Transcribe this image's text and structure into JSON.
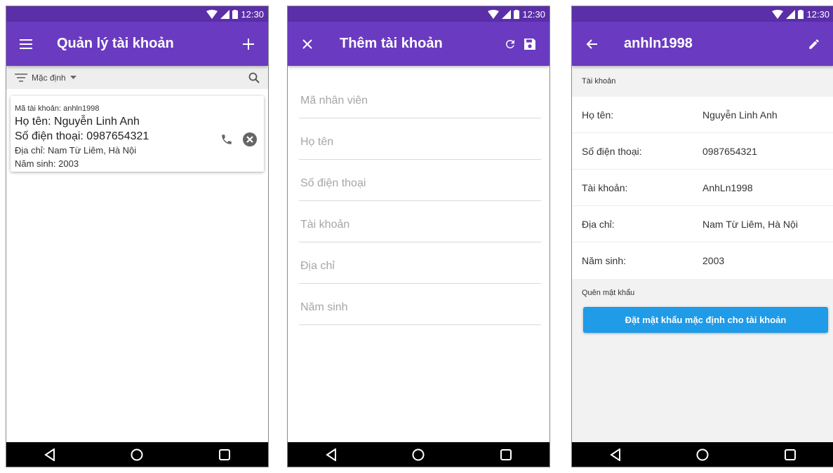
{
  "status": {
    "time": "12:30"
  },
  "screen_list": {
    "title": "Quản lý tài khoản",
    "sort_label": "Mặc định",
    "card": {
      "account_id": "Mã tài khoản: anhln1998",
      "name": "Họ tên: Nguyễn Linh Anh",
      "phone": "Số điện thoại: 0987654321",
      "address": "Địa chỉ: Nam Từ Liêm, Hà Nội",
      "birth_year": "Năm sinh: 2003"
    }
  },
  "screen_add": {
    "title": "Thêm tài khoản",
    "fields": [
      {
        "placeholder": "Mã nhân viên",
        "value": ""
      },
      {
        "placeholder": "Họ tên",
        "value": ""
      },
      {
        "placeholder": "Số điện thoại",
        "value": ""
      },
      {
        "placeholder": "Tài khoản",
        "value": ""
      },
      {
        "placeholder": "Địa chỉ",
        "value": ""
      },
      {
        "placeholder": "Năm sinh",
        "value": ""
      }
    ]
  },
  "screen_detail": {
    "title": "anhln1998",
    "section_account": "Tài khoản",
    "rows": [
      {
        "label": "Họ tên:",
        "value": "Nguyễn Linh Anh"
      },
      {
        "label": "Số điện thoại:",
        "value": "0987654321"
      },
      {
        "label": "Tài khoản:",
        "value": "AnhLn1998"
      },
      {
        "label": "Địa chỉ:",
        "value": "Nam Từ Liêm, Hà Nội"
      },
      {
        "label": "Năm sinh:",
        "value": "2003"
      }
    ],
    "section_password": "Quên mật khẩu",
    "reset_button": "Đặt mật khẩu mặc định cho tài khoản"
  },
  "icons": {
    "menu": "menu-icon",
    "add": "plus-icon",
    "filter": "filter-icon",
    "search": "search-icon",
    "phone": "phone-icon",
    "delete": "cancel-circle-icon",
    "close": "close-icon",
    "refresh": "refresh-icon",
    "save": "save-icon",
    "back": "arrow-back-icon",
    "edit": "pencil-icon"
  },
  "colors": {
    "statusbar": "#5b2fa8",
    "appbar": "#6a3bc0",
    "button": "#1f9be8"
  }
}
